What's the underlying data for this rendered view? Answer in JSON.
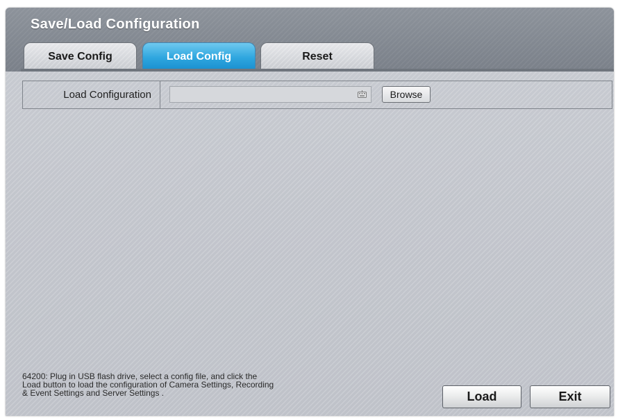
{
  "window": {
    "title": "Save/Load Configuration"
  },
  "tabs": [
    {
      "label": "Save Config",
      "active": false
    },
    {
      "label": "Load Config",
      "active": true
    },
    {
      "label": "Reset",
      "active": false
    }
  ],
  "load_row": {
    "label": "Load Configuration",
    "file_value": "",
    "icon": "keyboard-icon",
    "browse_label": "Browse"
  },
  "help": {
    "lines": [
      "64200: Plug in USB flash drive, select a config file, and click the",
      "Load button to load the configuration of Camera Settings, Recording",
      "& Event Settings and Server Settings ."
    ]
  },
  "actions": {
    "load_label": "Load",
    "exit_label": "Exit"
  },
  "colors": {
    "active_tab": "#2ea6df",
    "titlebar": "#7f858e",
    "panel": "#c4c7cd"
  }
}
